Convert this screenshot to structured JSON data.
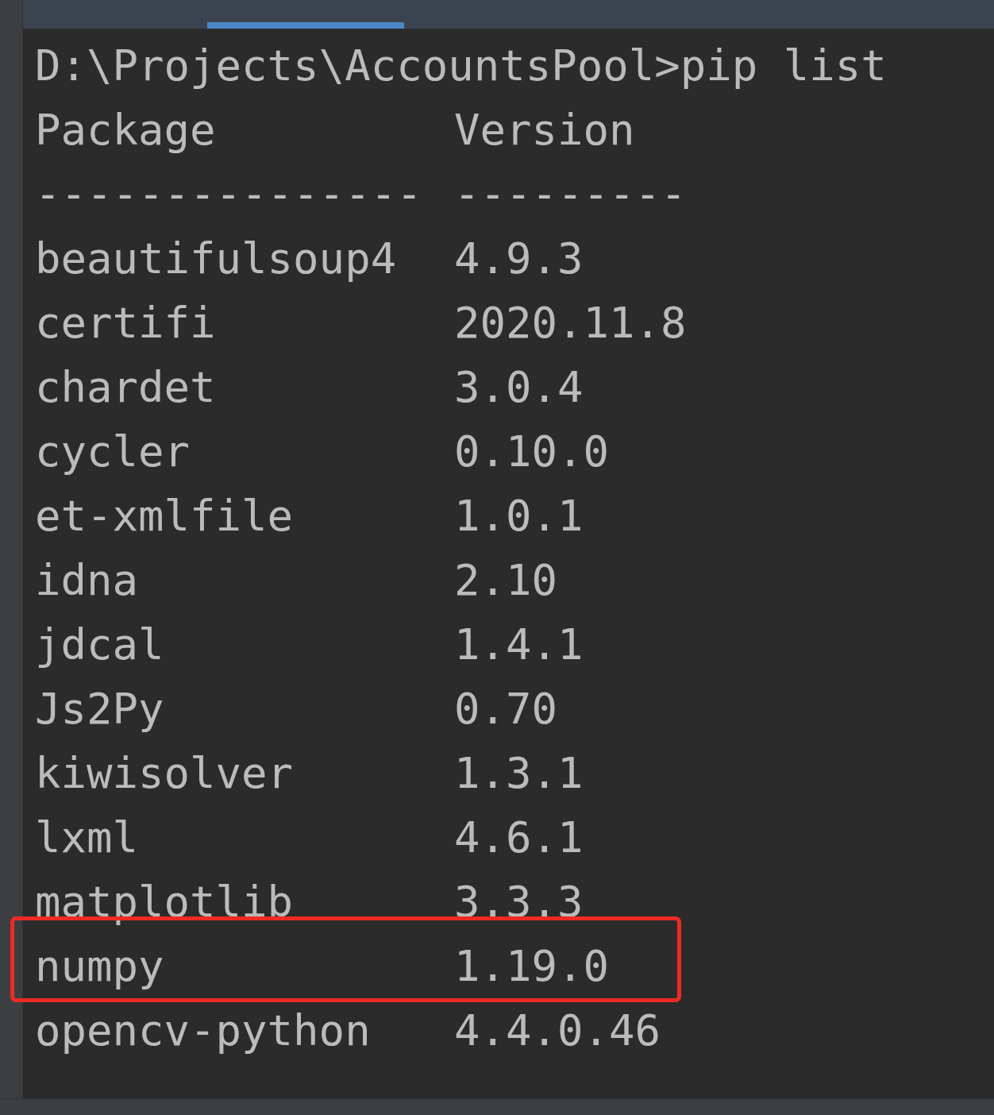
{
  "command_line": "D:\\Projects\\AccountsPool>pip list",
  "columns": [
    "Package",
    "Version"
  ],
  "rule": [
    "---------------",
    "---------"
  ],
  "rows": [
    {
      "package": "beautifulsoup4",
      "version": "4.9.3",
      "selected": false
    },
    {
      "package": "certifi",
      "version": "2020.11.8",
      "selected": false
    },
    {
      "package": "chardet",
      "version": "3.0.4",
      "selected": false
    },
    {
      "package": "cycler",
      "version": "0.10.0",
      "selected": false
    },
    {
      "package": "et-xmlfile",
      "version": "1.0.1",
      "selected": false
    },
    {
      "package": "idna",
      "version": "2.10",
      "selected": false
    },
    {
      "package": "jdcal",
      "version": "1.4.1",
      "selected": false
    },
    {
      "package": "Js2Py",
      "version": "0.70",
      "selected": false
    },
    {
      "package": "kiwisolver",
      "version": "1.3.1",
      "selected": false
    },
    {
      "package": "lxml",
      "version": "4.6.1",
      "selected": false
    },
    {
      "package": "matplotlib",
      "version": "3.3.3",
      "selected": false
    },
    {
      "package": "numpy",
      "version": "1.19.0",
      "selected": true
    },
    {
      "package": "opencv-python",
      "version": "4.4.0.46",
      "selected": false
    }
  ]
}
